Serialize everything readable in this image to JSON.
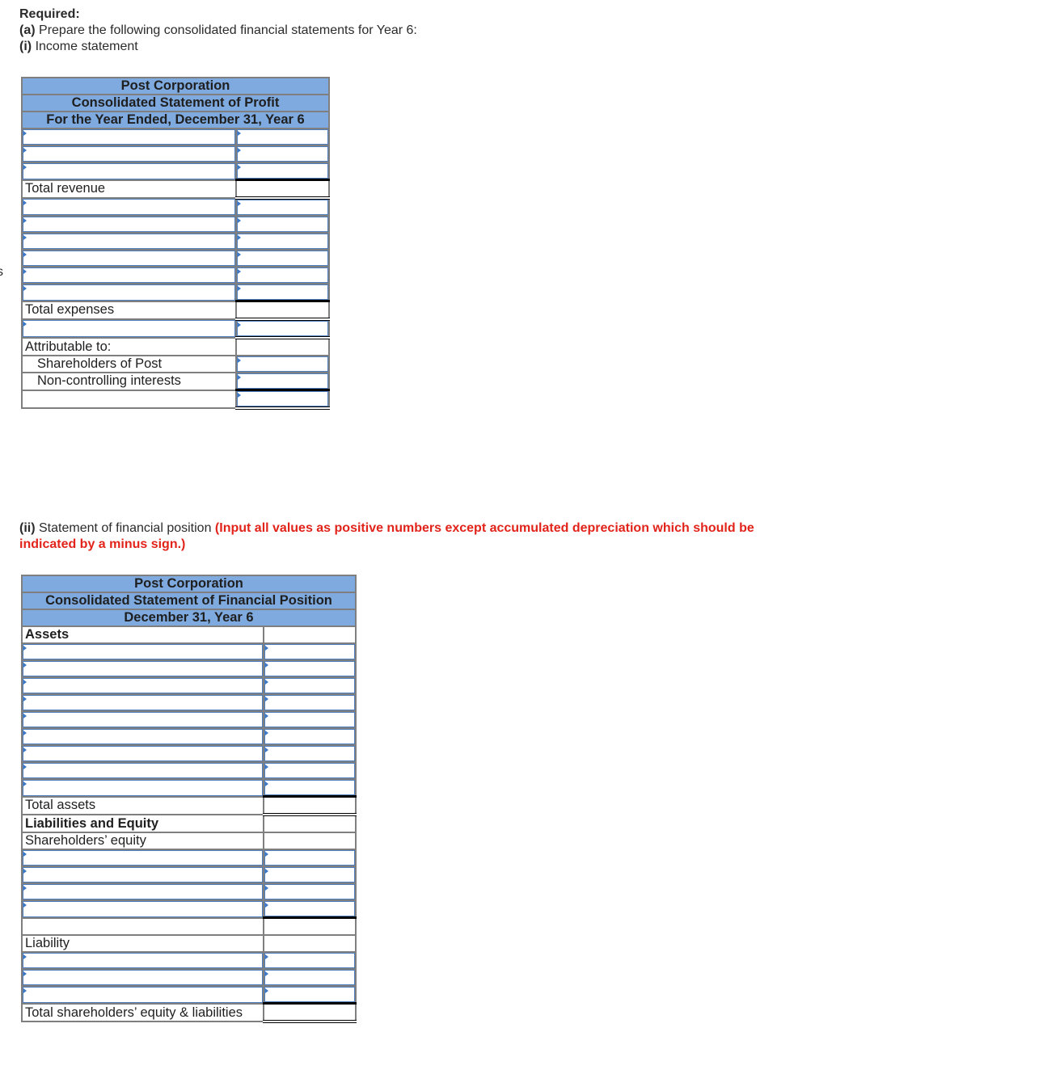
{
  "instructions": {
    "required_label": "Required:",
    "part_a_prefix": "(a)",
    "part_a_text": "Prepare the following consolidated financial statements for Year 6:",
    "part_i_prefix": "(i)",
    "part_i_text": "Income statement",
    "edge_char": "s"
  },
  "income_statement": {
    "company": "Post Corporation",
    "title": "Consolidated Statement of Profit",
    "period": "For the Year Ended, December 31, Year 6",
    "labels": {
      "total_revenue": "Total revenue",
      "total_expenses": "Total expenses",
      "attributable_to": "Attributable to:",
      "shareholders_of_post": "Shareholders of Post",
      "non_controlling_interests": "Non-controlling interests"
    },
    "revenue_rows": [
      {
        "label": "",
        "amount": ""
      },
      {
        "label": "",
        "amount": ""
      },
      {
        "label": "",
        "amount": ""
      }
    ],
    "expense_rows": [
      {
        "label": "",
        "amount": ""
      },
      {
        "label": "",
        "amount": ""
      },
      {
        "label": "",
        "amount": ""
      },
      {
        "label": "",
        "amount": ""
      },
      {
        "label": "",
        "amount": ""
      },
      {
        "label": "",
        "amount": ""
      }
    ],
    "profit_row": {
      "label": "",
      "amount": ""
    },
    "shareholders_of_post_amount": "",
    "nci_amount": "",
    "total_attributed_amount": ""
  },
  "part_ii": {
    "prefix": "(ii)",
    "text": "Statement of financial position",
    "warning": "(Input all values as positive numbers except accumulated depreciation which should be indicated by a minus sign.)"
  },
  "financial_position": {
    "company": "Post Corporation",
    "title": "Consolidated Statement of Financial Position",
    "date": "December 31, Year 6",
    "labels": {
      "assets": "Assets",
      "total_assets": "Total assets",
      "liabilities_and_equity": "Liabilities and Equity",
      "shareholders_equity": "Shareholders’ equity",
      "liability": "Liability",
      "total_equity_liabilities": "Total shareholders’ equity & liabilities"
    },
    "asset_rows": [
      {
        "label": "",
        "amount": ""
      },
      {
        "label": "",
        "amount": ""
      },
      {
        "label": "",
        "amount": ""
      },
      {
        "label": "",
        "amount": ""
      },
      {
        "label": "",
        "amount": ""
      },
      {
        "label": "",
        "amount": ""
      },
      {
        "label": "",
        "amount": ""
      },
      {
        "label": "",
        "amount": ""
      },
      {
        "label": "",
        "amount": ""
      }
    ],
    "equity_rows": [
      {
        "label": "",
        "amount": ""
      },
      {
        "label": "",
        "amount": ""
      },
      {
        "label": "",
        "amount": ""
      },
      {
        "label": "",
        "amount": ""
      }
    ],
    "liability_rows": [
      {
        "label": "",
        "amount": ""
      },
      {
        "label": "",
        "amount": ""
      },
      {
        "label": "",
        "amount": ""
      }
    ]
  },
  "colors": {
    "header_blue": "#7eaadf",
    "input_border": "#4f7fbf",
    "warning_red": "#e2231a",
    "grid_gray": "#7f7f7f"
  }
}
